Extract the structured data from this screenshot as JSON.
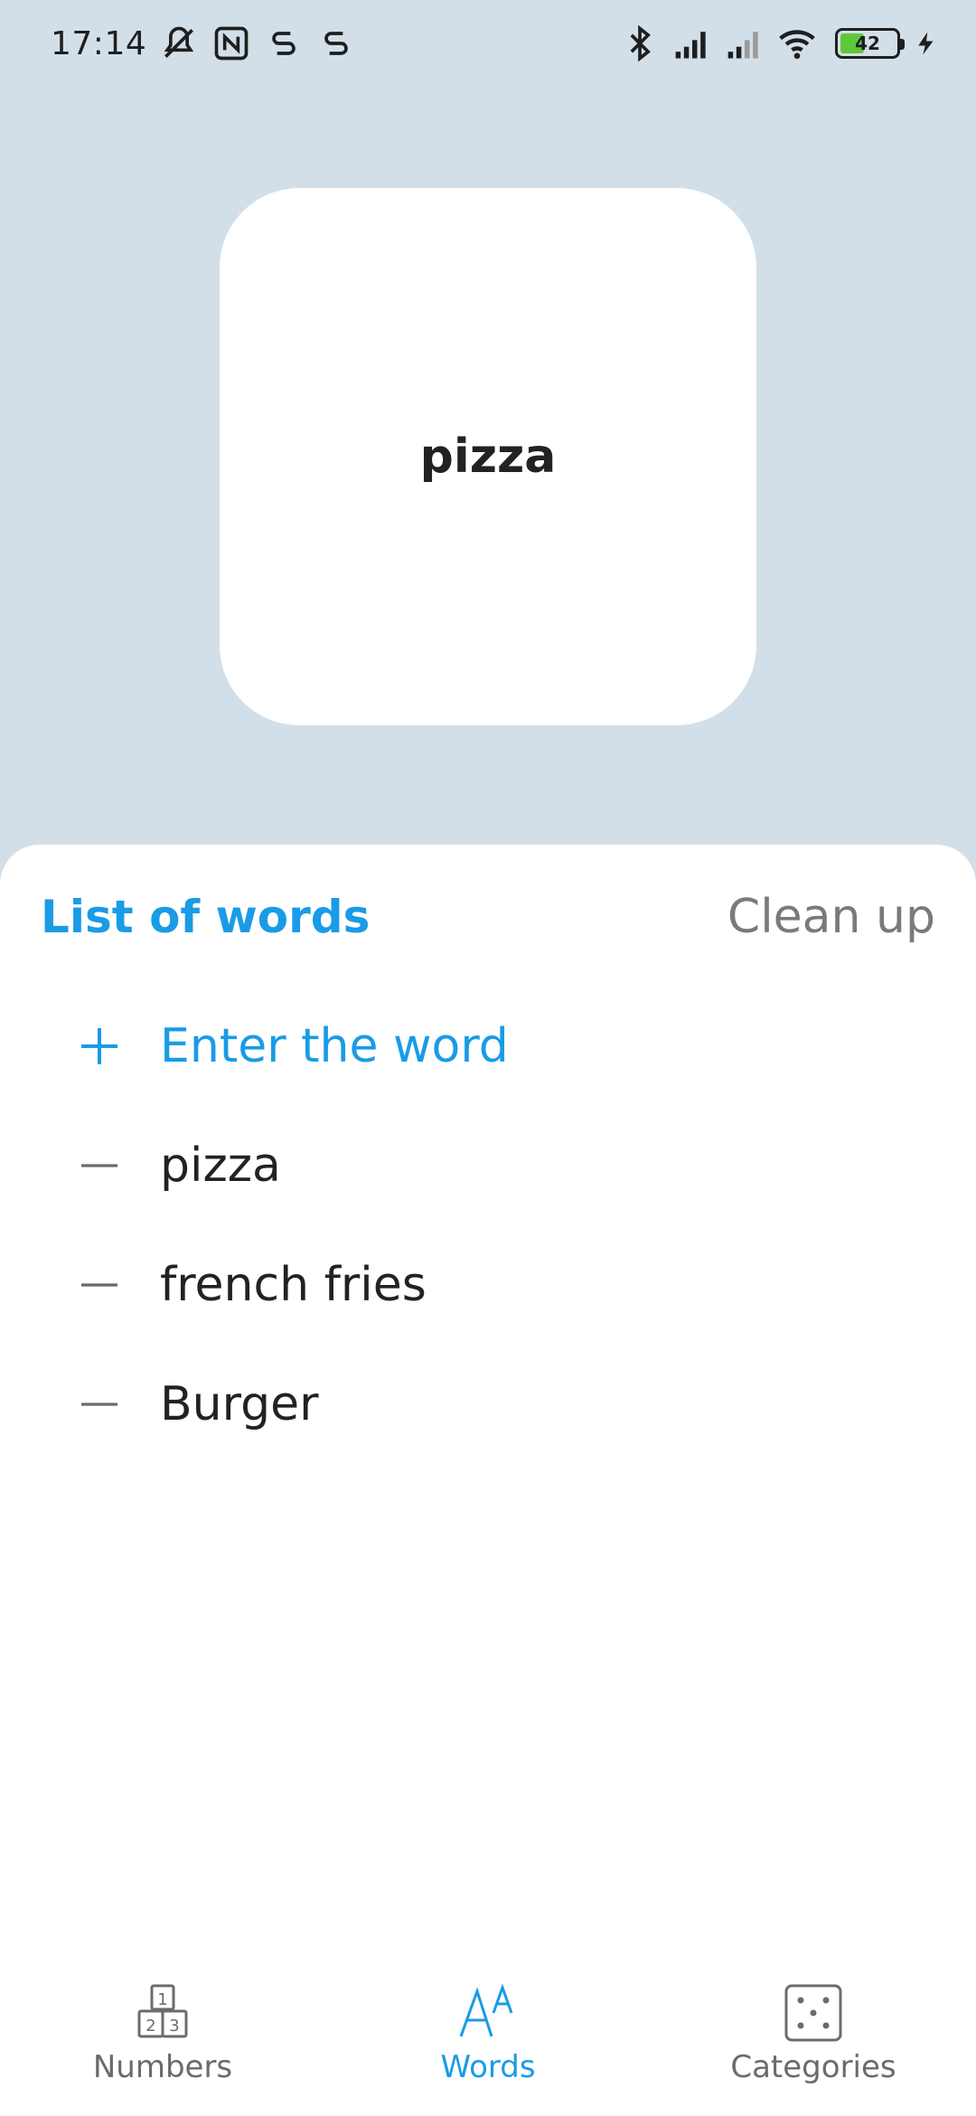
{
  "status_bar": {
    "time": "17:14",
    "battery_level": "42",
    "icons_left": [
      "mute-icon",
      "nfc-icon",
      "sim-s-icon",
      "sim-s-icon"
    ],
    "icons_right": [
      "bluetooth-icon",
      "signal-icon",
      "signal-icon",
      "wifi-icon",
      "battery-icon",
      "charging-icon"
    ]
  },
  "card": {
    "word": "pizza"
  },
  "sheet": {
    "title": "List of words",
    "clean_up_label": "Clean up",
    "add_placeholder": "Enter the word",
    "words": [
      "pizza",
      "french fries",
      "Burger"
    ]
  },
  "nav": {
    "items": [
      {
        "label": "Numbers",
        "icon": "numbers-icon",
        "active": false
      },
      {
        "label": "Words",
        "icon": "words-icon",
        "active": true
      },
      {
        "label": "Categories",
        "icon": "dice-icon",
        "active": false
      }
    ]
  },
  "colors": {
    "accent": "#1a9be6",
    "background": "#d3dfe8",
    "muted": "#7a7a7a"
  }
}
